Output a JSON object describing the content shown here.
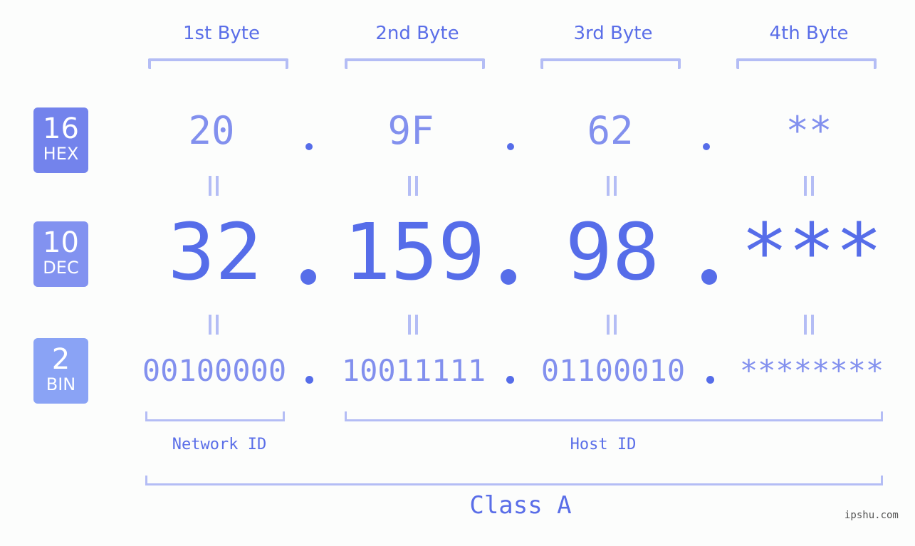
{
  "headers": {
    "bytes": [
      "1st Byte",
      "2nd Byte",
      "3rd Byte",
      "4th Byte"
    ]
  },
  "badges": {
    "hex": {
      "num": "16",
      "unit": "HEX",
      "color": "#7383ec"
    },
    "dec": {
      "num": "10",
      "unit": "DEC",
      "color": "#8292f0"
    },
    "bin": {
      "num": "2",
      "unit": "BIN",
      "color": "#8aa3f5"
    }
  },
  "hex": [
    "20",
    "9F",
    "62",
    "**"
  ],
  "dec": [
    "32",
    "159",
    "98",
    "***"
  ],
  "bin": [
    "00100000",
    "10011111",
    "01100010",
    "********"
  ],
  "segments": {
    "network": "Network ID",
    "host": "Host ID"
  },
  "class_label": "Class A",
  "watermark": "ipshu.com",
  "colors": {
    "primary": "#566de9",
    "light": "#8290ee",
    "bracket": "#b4bdf5"
  }
}
